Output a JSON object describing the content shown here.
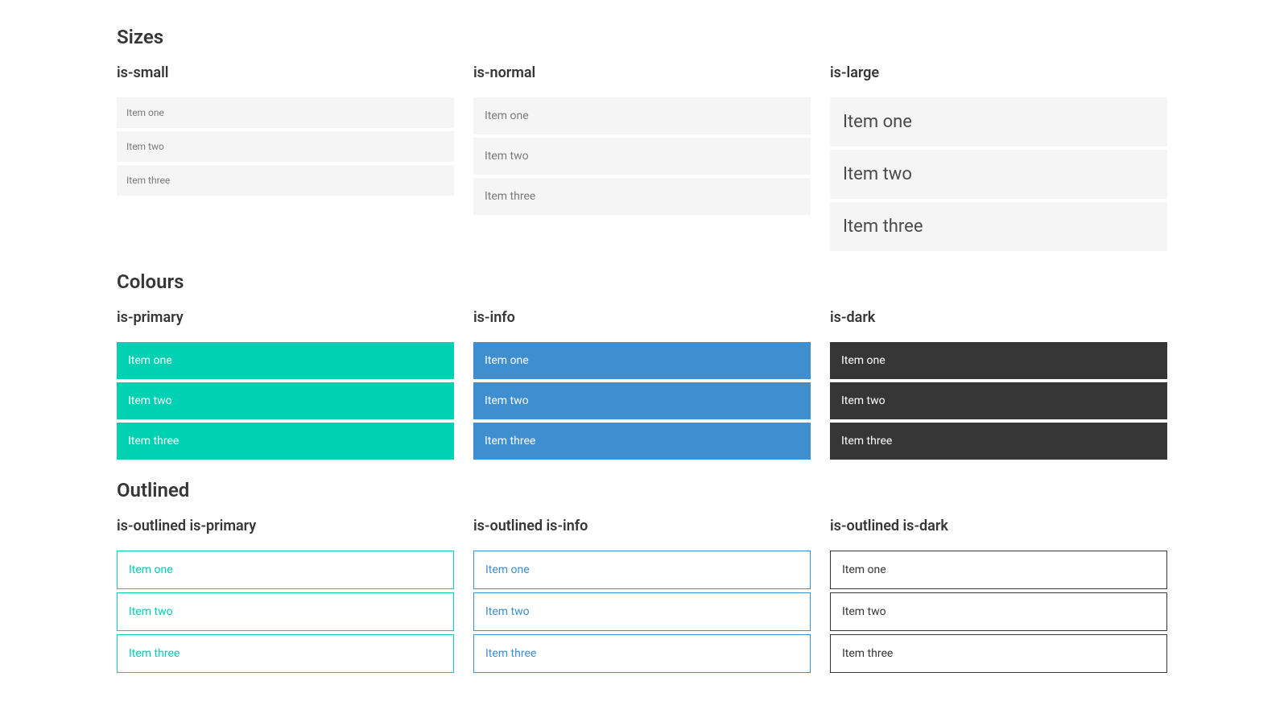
{
  "sections": {
    "sizes": {
      "title": "Sizes",
      "variants": {
        "small": {
          "label": "is-small",
          "items": [
            "Item one",
            "Item two",
            "Item three"
          ]
        },
        "normal": {
          "label": "is-normal",
          "items": [
            "Item one",
            "Item two",
            "Item three"
          ]
        },
        "large": {
          "label": "is-large",
          "items": [
            "Item one",
            "Item two",
            "Item three"
          ]
        }
      }
    },
    "colours": {
      "title": "Colours",
      "variants": {
        "primary": {
          "label": "is-primary",
          "items": [
            "Item one",
            "Item two",
            "Item three"
          ]
        },
        "info": {
          "label": "is-info",
          "items": [
            "Item one",
            "Item two",
            "Item three"
          ]
        },
        "dark": {
          "label": "is-dark",
          "items": [
            "Item one",
            "Item two",
            "Item three"
          ]
        }
      }
    },
    "outlined": {
      "title": "Outlined",
      "variants": {
        "primary": {
          "label": "is-outlined is-primary",
          "items": [
            "Item one",
            "Item two",
            "Item three"
          ]
        },
        "info": {
          "label": "is-outlined is-info",
          "items": [
            "Item one",
            "Item two",
            "Item three"
          ]
        },
        "dark": {
          "label": "is-outlined is-dark",
          "items": [
            "Item one",
            "Item two",
            "Item three"
          ]
        }
      }
    }
  }
}
